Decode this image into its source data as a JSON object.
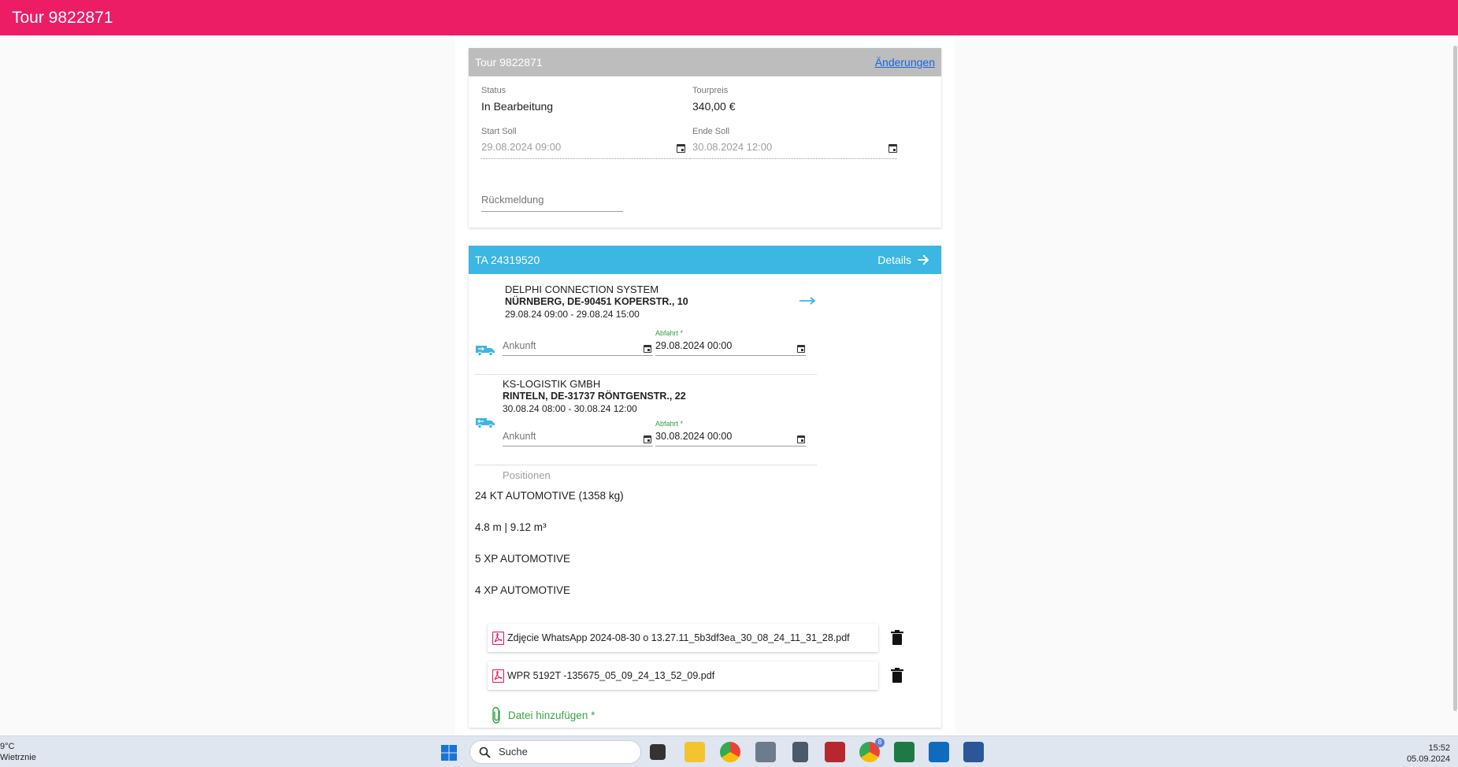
{
  "app_title": "Tour 9822871",
  "tour_card": {
    "title": "Tour 9822871",
    "changes_link": "Änderungen",
    "status_label": "Status",
    "status_value": "In Bearbeitung",
    "price_label": "Tourpreis",
    "price_value": "340,00 €",
    "start_label": "Start Soll",
    "start_value": "29.08.2024 09:00",
    "end_label": "Ende Soll",
    "end_value": "30.08.2024 12:00",
    "feedback_placeholder": "Rückmeldung"
  },
  "ta_card": {
    "title": "TA 24319520",
    "details_label": "Details",
    "stops": [
      {
        "name": "DELPHI CONNECTION SYSTEM",
        "address": "NÜRNBERG, DE-90451 KOPERSTR., 10",
        "time": "29.08.24 09:00 - 29.08.24 15:00",
        "arrival_placeholder": "Ankunft",
        "departure_label": "Abfahrt *",
        "departure_value": "29.08.2024 00:00"
      },
      {
        "name": "KS-LOGISTIK GMBH",
        "address": "RINTELN, DE-31737 RÖNTGENSTR., 22",
        "time": "30.08.24 08:00 - 30.08.24 12:00",
        "arrival_placeholder": "Ankunft",
        "departure_label": "Abfahrt *",
        "departure_value": "30.08.2024 00:00"
      }
    ],
    "positions_label": "Positionen",
    "positions": [
      "24 KT AUTOMOTIVE (1358 kg)",
      "4.8 m | 9.12 m³",
      "5 XP AUTOMOTIVE",
      "4 XP AUTOMOTIVE"
    ],
    "files": [
      "Zdjęcie WhatsApp 2024-08-30 o 13.27.11_5b3df3ea_30_08_24_11_31_28.pdf",
      "WPR 5192T -135675_05_09_24_13_52_09.pdf"
    ],
    "add_file_label": "Datei hinzufügen *"
  },
  "taskbar": {
    "temperature": "9°C",
    "weather": "Wietrznie",
    "search": "Suche",
    "chrome_badge": "8",
    "time": "15:52",
    "date": "05.09.2024"
  },
  "colors": {
    "appbar": "#ec1c65",
    "ta_header": "#3cb6e3",
    "link": "#1565e5",
    "accent_green": "#3aa34b"
  }
}
